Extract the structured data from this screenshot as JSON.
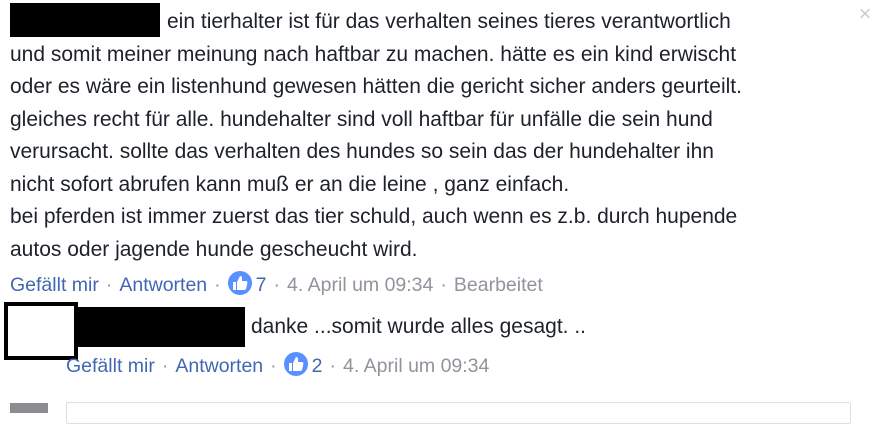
{
  "comment": {
    "lines": [
      "ein tierhalter ist für das verhalten seines tieres verantwortlich",
      "und somit meiner meinung nach haftbar zu machen. hätte es ein kind erwischt",
      "oder es wäre ein listenhund gewesen hätten die gericht sicher anders geurteilt.",
      "gleiches recht für alle. hundehalter sind voll haftbar für unfälle die sein hund",
      "verursacht. sollte das verhalten des hundes so sein das der hundehalter ihn",
      "nicht sofort abrufen kann muß er an die leine , ganz einfach.",
      "bei pferden ist immer zuerst das tier schuld, auch wenn es z.b. durch hupende",
      "autos oder jagende hunde gescheucht wird."
    ],
    "actions": {
      "like_label": "Gefällt mir",
      "reply_label": "Antworten",
      "like_count": "7",
      "timestamp": "4. April um 09:34",
      "edited_label": "Bearbeitet"
    }
  },
  "reply": {
    "text": "danke ...somit wurde alles gesagt. ..",
    "actions": {
      "like_label": "Gefällt mir",
      "reply_label": "Antworten",
      "like_count": "2",
      "timestamp": "4. April um 09:34"
    }
  },
  "close_glyph": "×",
  "separator": "·",
  "colors": {
    "link": "#4267b2",
    "meta": "#90949c",
    "like_badge": "#5890ff",
    "text": "#1d2129"
  }
}
